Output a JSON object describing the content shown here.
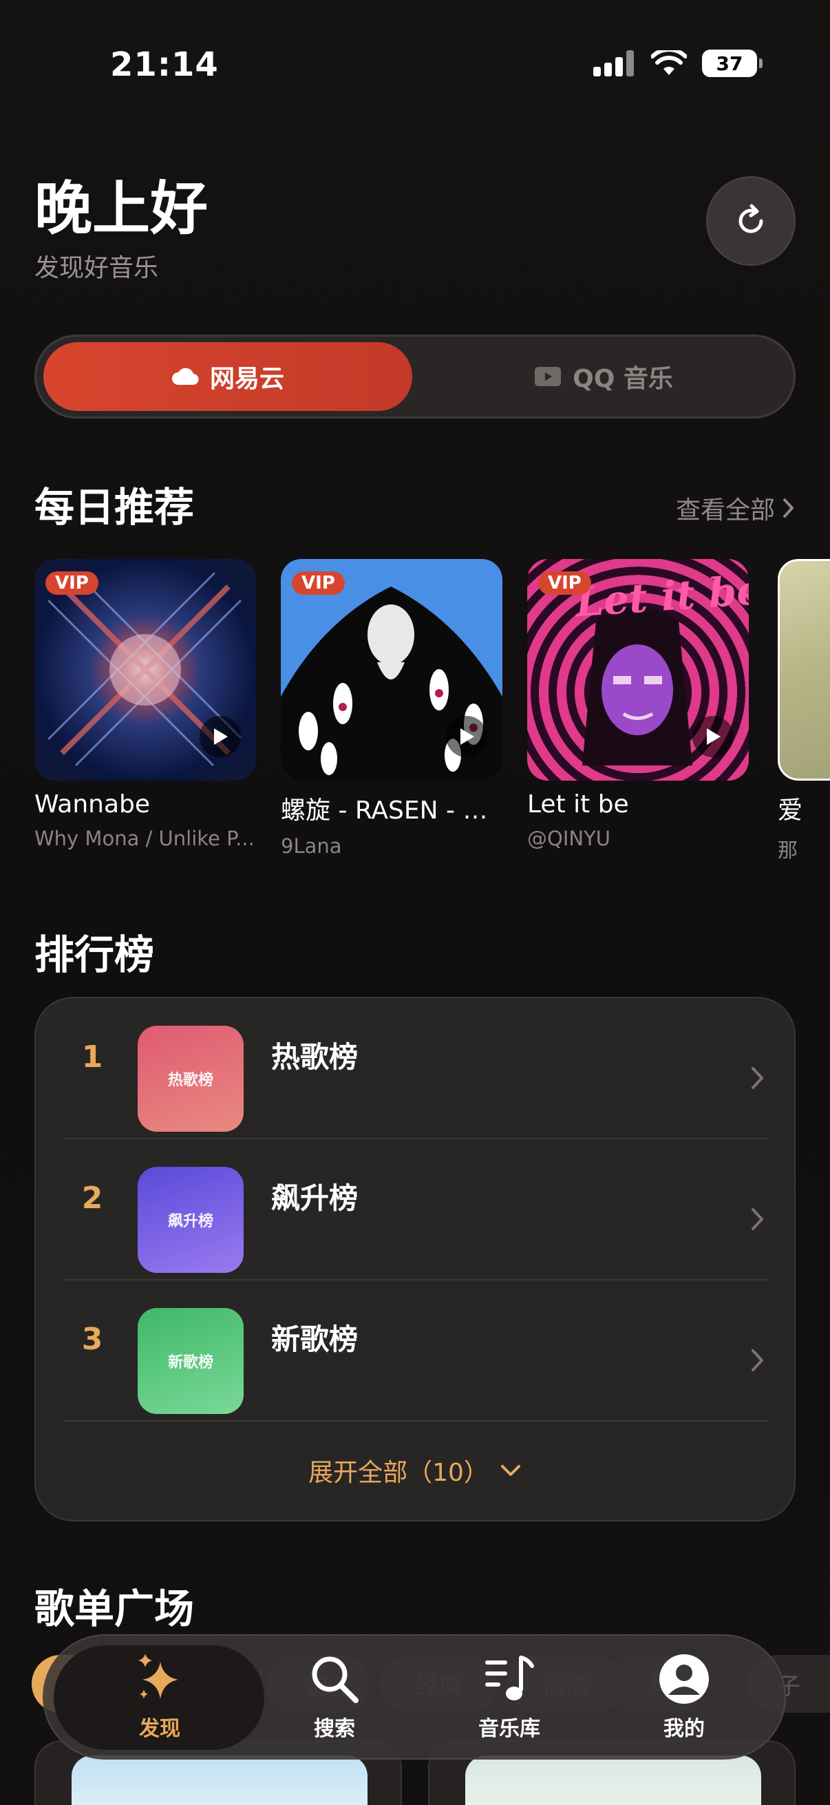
{
  "status": {
    "time": "21:14",
    "battery": "37"
  },
  "header": {
    "greeting": "晚上好",
    "subtitle": "发现好音乐"
  },
  "source_switch": {
    "active": "网易云",
    "inactive": "QQ 音乐"
  },
  "daily": {
    "title": "每日推荐",
    "see_all": "查看全部",
    "items": [
      {
        "title": "Wannabe",
        "artist": "Why Mona / Unlike P...",
        "vip": "VIP"
      },
      {
        "title": "螺旋 - RASEN - A...",
        "artist": "9Lana",
        "vip": "VIP"
      },
      {
        "title": "Let it be",
        "artist": "@QINYU",
        "vip": "VIP",
        "cover_text": "Let it be"
      },
      {
        "title": "爱",
        "artist": "那"
      }
    ]
  },
  "charts": {
    "title": "排行榜",
    "items": [
      {
        "rank": "1",
        "name": "热歌榜",
        "thumb": "热歌榜",
        "color": "#e06a78"
      },
      {
        "rank": "2",
        "name": "飙升榜",
        "thumb": "飙升榜",
        "color": "#7a62e6"
      },
      {
        "rank": "3",
        "name": "新歌榜",
        "thumb": "新歌榜",
        "color": "#5bc87c"
      }
    ],
    "expand": "展开全部（10）"
  },
  "playlists": {
    "title": "歌单广场",
    "chips": [
      "流",
      "经典",
      "摇滚",
      "E",
      "子"
    ]
  },
  "tabbar": {
    "items": [
      {
        "label": "发现"
      },
      {
        "label": "搜索"
      },
      {
        "label": "音乐库"
      },
      {
        "label": "我的"
      }
    ]
  },
  "colors": {
    "accent": "#d8452f",
    "gold": "#e7a95a"
  }
}
